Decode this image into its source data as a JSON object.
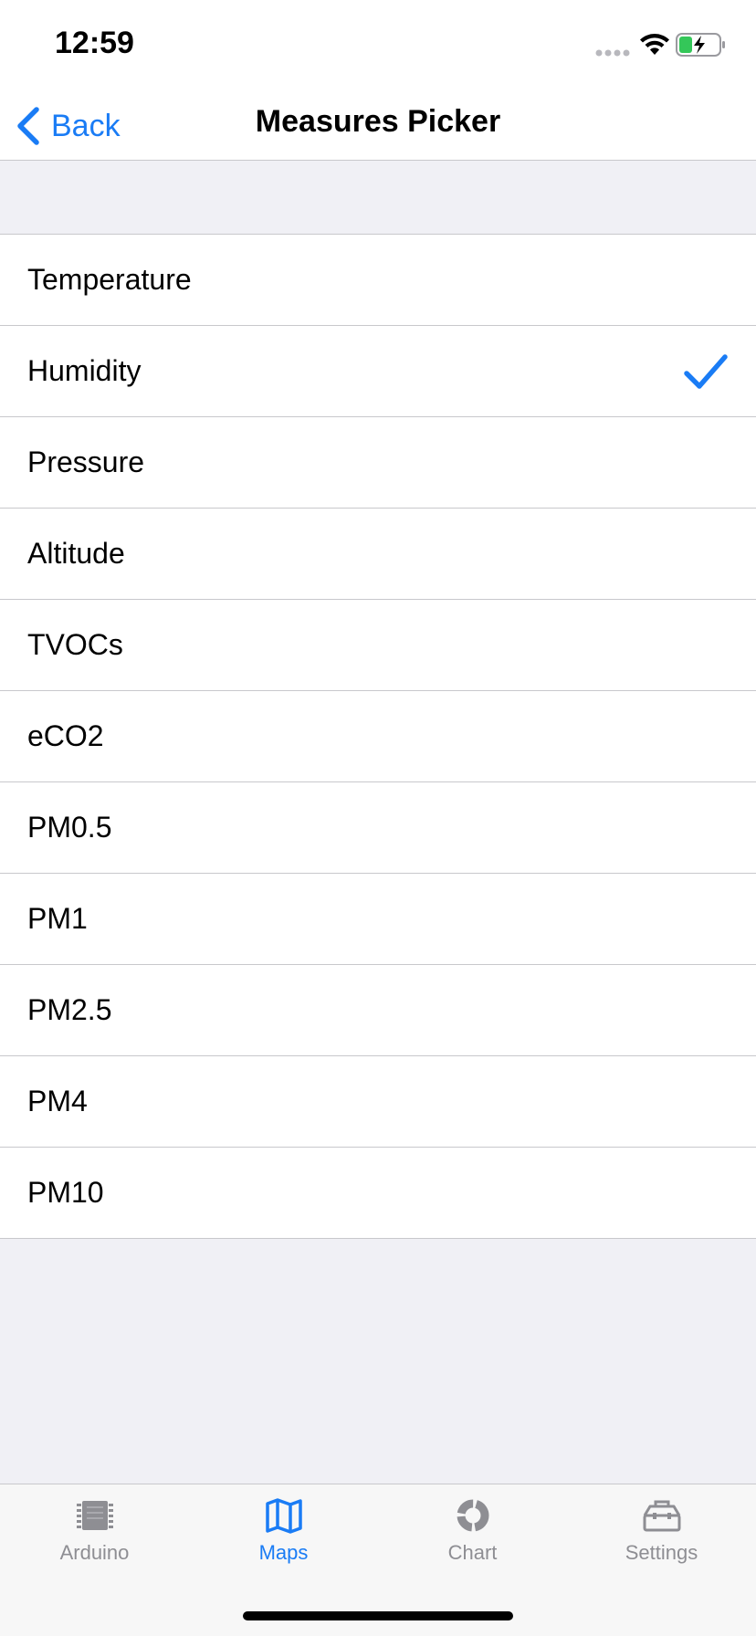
{
  "status_bar": {
    "time": "12:59"
  },
  "nav": {
    "back_label": "Back",
    "title": "Measures Picker"
  },
  "measures": {
    "items": [
      {
        "label": "Temperature",
        "selected": false
      },
      {
        "label": "Humidity",
        "selected": true
      },
      {
        "label": "Pressure",
        "selected": false
      },
      {
        "label": "Altitude",
        "selected": false
      },
      {
        "label": "TVOCs",
        "selected": false
      },
      {
        "label": "eCO2",
        "selected": false
      },
      {
        "label": "PM0.5",
        "selected": false
      },
      {
        "label": "PM1",
        "selected": false
      },
      {
        "label": "PM2.5",
        "selected": false
      },
      {
        "label": "PM4",
        "selected": false
      },
      {
        "label": "PM10",
        "selected": false
      }
    ]
  },
  "tab_bar": {
    "tabs": [
      {
        "label": "Arduino",
        "icon": "chip-icon",
        "active": false
      },
      {
        "label": "Maps",
        "icon": "map-icon",
        "active": true
      },
      {
        "label": "Chart",
        "icon": "donut-chart-icon",
        "active": false
      },
      {
        "label": "Settings",
        "icon": "toolbox-icon",
        "active": false
      }
    ]
  },
  "colors": {
    "accent": "#1a7cf5",
    "inactive": "#8e8e93",
    "background": "#f0f0f5",
    "battery_fill": "#34c759"
  }
}
